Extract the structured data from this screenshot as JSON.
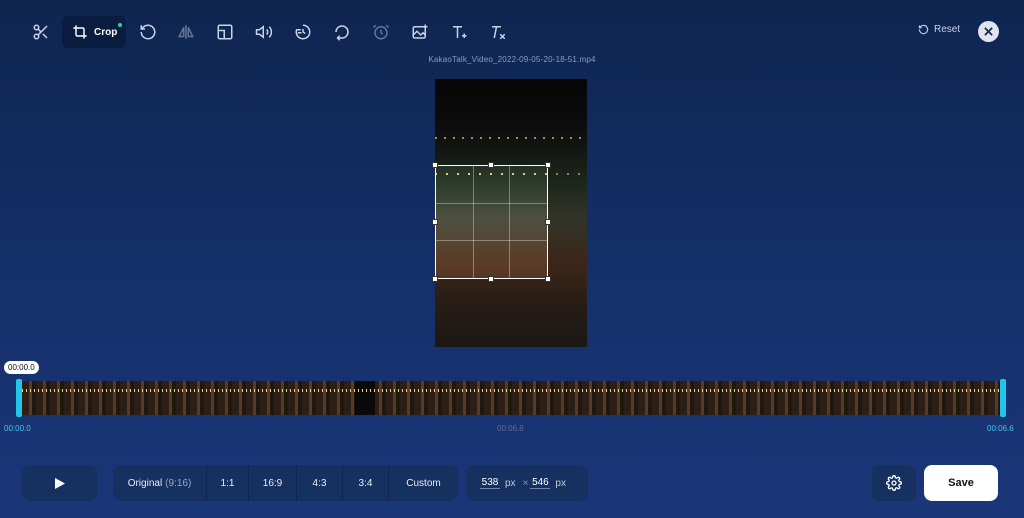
{
  "toolbar": {
    "crop_label": "Crop",
    "reset_label": "Reset",
    "active_dot_color": "#2fd3a0",
    "icons": [
      "scissors-icon",
      "crop-icon",
      "rotate-icon",
      "flip-icon",
      "layout-icon",
      "volume-icon",
      "speed-icon",
      "loop-icon",
      "timer-icon",
      "image-add-icon",
      "text-add-icon",
      "remove-text-icon",
      "reset-icon",
      "close-icon"
    ]
  },
  "video": {
    "filename": "KakaoTalk_Video_2022-09-05-20-18-51.mp4"
  },
  "timeline": {
    "current_time": "00:00.0",
    "start_label": "00:00.0",
    "mid_label": "00:06.6",
    "end_label": "00:06.6",
    "accent_color": "#23c5e8"
  },
  "bottom": {
    "ratios": [
      {
        "label": "Original",
        "sub": "(9:16)"
      },
      {
        "label": "1:1",
        "sub": ""
      },
      {
        "label": "16:9",
        "sub": ""
      },
      {
        "label": "4:3",
        "sub": ""
      },
      {
        "label": "3:4",
        "sub": ""
      },
      {
        "label": "Custom",
        "sub": ""
      }
    ],
    "width_value": "538",
    "height_value": "546",
    "unit": "px",
    "times_symbol": "×",
    "save_label": "Save"
  }
}
